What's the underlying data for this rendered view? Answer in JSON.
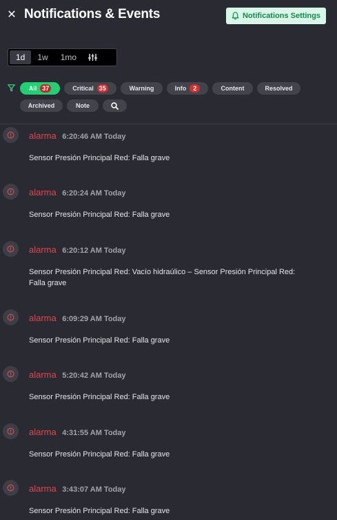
{
  "header": {
    "title": "Notifications & Events",
    "close_icon": "close-icon",
    "settings_label": "Notifications Settings",
    "settings_icon": "bell-icon",
    "accent_color": "#1fd173"
  },
  "time_range": {
    "options": [
      "1d",
      "1w",
      "1mo"
    ],
    "selected": "1d",
    "extra_icon": "sliders-icon"
  },
  "filters": {
    "icon": "funnel-icon",
    "chips": [
      {
        "label": "All",
        "count": "37",
        "active": true
      },
      {
        "label": "Critical",
        "count": "35"
      },
      {
        "label": "Warning"
      },
      {
        "label": "Info",
        "count": "2"
      },
      {
        "label": "Content"
      },
      {
        "label": "Resolved"
      },
      {
        "label": "Archived"
      },
      {
        "label": "Note"
      }
    ],
    "search_icon": "search-icon"
  },
  "events": [
    {
      "type": "alarma",
      "time": "6:20:46 AM Today",
      "message": "Sensor Presión Principal Red: Falla grave"
    },
    {
      "type": "alarma",
      "time": "6:20:24 AM Today",
      "message": "Sensor Presión Principal Red: Falla grave"
    },
    {
      "type": "alarma",
      "time": "6:20:12 AM Today",
      "message": "Sensor Presión Principal Red: Vacío hidraúlico – Sensor Presión Principal Red: Falla grave"
    },
    {
      "type": "alarma",
      "time": "6:09:29 AM Today",
      "message": "Sensor Presión Principal Red: Falla grave"
    },
    {
      "type": "alarma",
      "time": "5:20:42 AM Today",
      "message": "Sensor Presión Principal Red: Falla grave"
    },
    {
      "type": "alarma",
      "time": "4:31:55 AM Today",
      "message": "Sensor Presión Principal Red: Falla grave"
    },
    {
      "type": "alarma",
      "time": "3:43:07 AM Today",
      "message": "Sensor Presión Principal Red: Falla grave"
    }
  ]
}
